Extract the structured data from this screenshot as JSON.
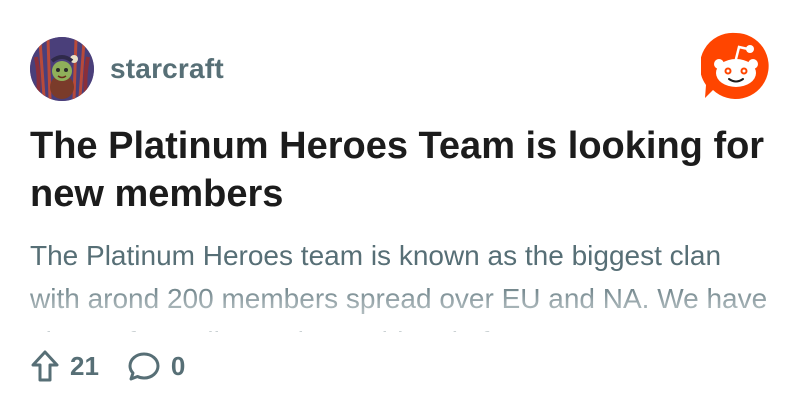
{
  "post": {
    "subreddit": "starcraft",
    "title": "The Platinum Heroes Team is looking for new members",
    "body": "The Platinum Heroes team is known as the biggest clan with arond 200 members spread over EU and NA. We have players from all over the world and of any",
    "upvotes": "21",
    "comments": "0"
  },
  "icons": {
    "avatar": "subreddit-avatar-icon",
    "logo": "reddit-snoo-icon",
    "upvote": "upvote-arrow-icon",
    "comment": "comment-bubble-icon"
  },
  "colors": {
    "brand": "#ff4500",
    "muted_text": "#576f76",
    "title_text": "#1c1c1c"
  }
}
